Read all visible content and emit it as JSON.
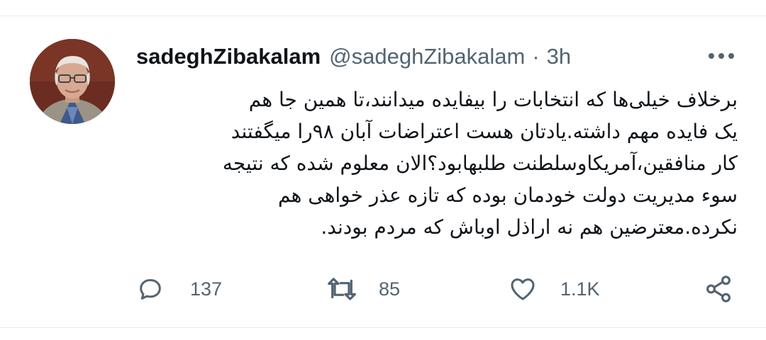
{
  "tweet": {
    "display_name": "sadeghZibakalam",
    "handle": "@sadeghZibakalam",
    "separator": "·",
    "time": "3h",
    "text_lines": [
      "برخلاف خیلی‌ها که انتخابات را بیفایده میدانند،تا همین جا هم",
      "یک فایده مهم داشته.یادتان هست اعتراضات آبان ۹۸را میگفتند",
      "کار منافقین،آمریکاوسلطنت طلبهابود؟الان معلوم شده که نتیجه",
      "سوء مدیریت دولت خودمان بوده که تازه عذر خواهی هم",
      "نکرده.معترضین هم نه اراذل اوباش که مردم بودند."
    ]
  },
  "actions": {
    "reply": {
      "icon": "reply-icon",
      "count": "137"
    },
    "retweet": {
      "icon": "retweet-icon",
      "count": "85"
    },
    "like": {
      "icon": "heart-icon",
      "count": "1.1K"
    },
    "share": {
      "icon": "share-icon"
    }
  },
  "icons": {
    "more": "more-horizontal-icon"
  },
  "colors": {
    "text_primary": "#0f1419",
    "text_secondary": "#536471",
    "divider": "#e6ecf0",
    "background": "#ffffff"
  }
}
